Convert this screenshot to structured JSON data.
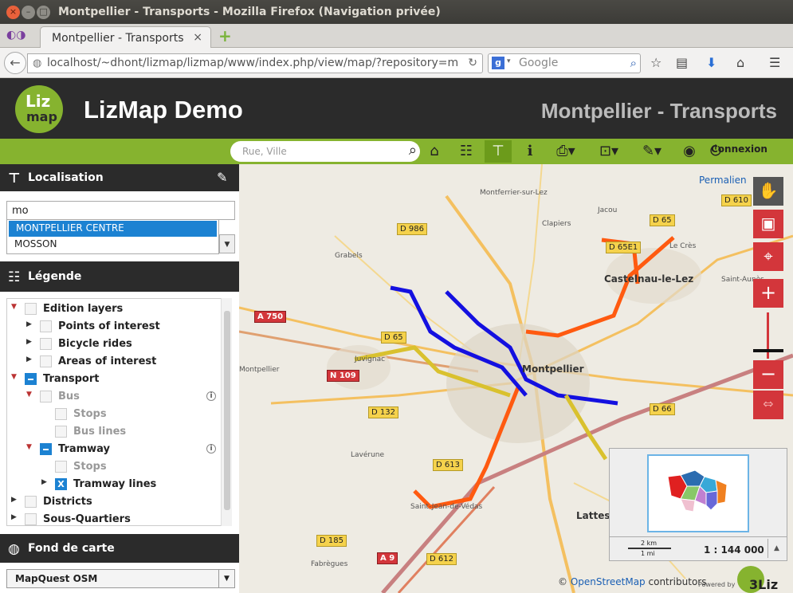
{
  "window": {
    "title": "Montpellier - Transports - Mozilla Firefox (Navigation privée)",
    "tab_title": "Montpellier - Transports"
  },
  "navbar": {
    "url": "localhost/~dhont/lizmap/lizmap/www/index.php/view/map/?repository=m",
    "search_placeholder": "Google"
  },
  "header": {
    "logo_top": "Liz",
    "logo_bottom": "map",
    "app_title": "LizMap Demo",
    "project_title": "Montpellier - Transports"
  },
  "toolbar": {
    "search_placeholder": "Rue, Ville",
    "login": "Connexion"
  },
  "localisation": {
    "title": "Localisation",
    "input_value": "mo",
    "options": [
      "MONTPELLIER CENTRE",
      "MOSSON"
    ],
    "selected_index": 0
  },
  "legend": {
    "title": "Légende",
    "items": [
      {
        "label": "Edition layers"
      },
      {
        "label": "Points of interest"
      },
      {
        "label": "Bicycle rides"
      },
      {
        "label": "Areas of interest"
      },
      {
        "label": "Transport"
      },
      {
        "label": "Bus"
      },
      {
        "label": "Stops"
      },
      {
        "label": "Bus lines"
      },
      {
        "label": "Tramway"
      },
      {
        "label": "Stops"
      },
      {
        "label": "Tramway lines",
        "check": "X"
      },
      {
        "label": "Districts"
      },
      {
        "label": "Sous-Quartiers"
      }
    ]
  },
  "basemap": {
    "title": "Fond de carte",
    "selected": "MapQuest OSM"
  },
  "map": {
    "permalink": "Permalien",
    "places": [
      "Montferrier-sur-Lez",
      "Jacou",
      "Clapiers",
      "Grabels",
      "Le Crès",
      "Castelnau-le-Lez",
      "Saint-Aunès",
      "Juvignac",
      "Montpellier",
      "Montpellier",
      "Lavérune",
      "Saint-Jean-de-Védas",
      "Lattes",
      "Fabrègues"
    ],
    "roads": [
      "D 610",
      "D 65",
      "D 986",
      "D 65E1",
      "A 750",
      "D 65",
      "N 109",
      "D 132",
      "D 66",
      "D 613",
      "D 185",
      "A 9",
      "D 612"
    ],
    "scale_km": "2 km",
    "scale_mi": "1 mi",
    "scale_value": "1 : 144 000",
    "attribution_prefix": "©",
    "attribution_link": "OpenStreetMap",
    "attribution_suffix": "contributors",
    "powered": "Powered by",
    "brand": "3Liz",
    "colors": {
      "tram_blue": "#1410e0",
      "tram_orange": "#ff5a10",
      "tram_yellow": "#d9c12e",
      "lizmap_green": "#86b32f",
      "lizmap_red": "#d3363b"
    }
  },
  "overview_colors": [
    "#2b6cb0",
    "#e02020",
    "#38a8d8",
    "#f08020",
    "#88c868",
    "#c080d0",
    "#6868d8",
    "#f0c0d0"
  ]
}
